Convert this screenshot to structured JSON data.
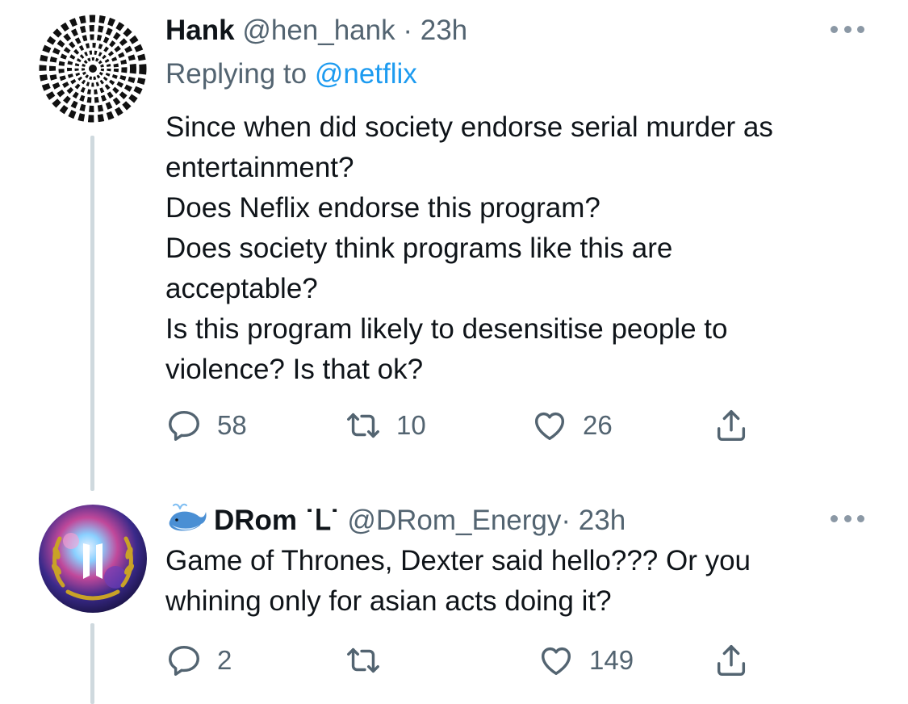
{
  "tweets": [
    {
      "name": "Hank",
      "handle": "@hen_hank",
      "sep": "·",
      "time": "23h",
      "replying_prefix": "Replying to",
      "replying_to": "@netflix",
      "lines": [
        "Since when did society endorse serial murder as",
        "entertainment?",
        "Does Neflix endorse this program?",
        "Does society think programs like this are",
        "acceptable?",
        "Is this program likely to desensitise people to",
        "violence? Is that ok?"
      ],
      "replies": "58",
      "retweets": "10",
      "likes": "26",
      "avatar_icon": "hypnotic-spiral-avatar"
    },
    {
      "name": "DRom ˙ᒪ˙",
      "handle": "@DRom_Energy",
      "sep": "·",
      "time": "23h",
      "lines": [
        "Game of Thrones, Dexter said hello??? Or you",
        "whining only for asian acts doing it?"
      ],
      "replies": "2",
      "retweets": "",
      "likes": "149",
      "avatar_icon": "galaxy-laurel-avatar",
      "name_emoji": "whale-emoji"
    }
  ],
  "colors": {
    "text": "#0f1419",
    "muted": "#536471",
    "link": "#1d9bf0",
    "thread_line": "#cfd9de"
  }
}
